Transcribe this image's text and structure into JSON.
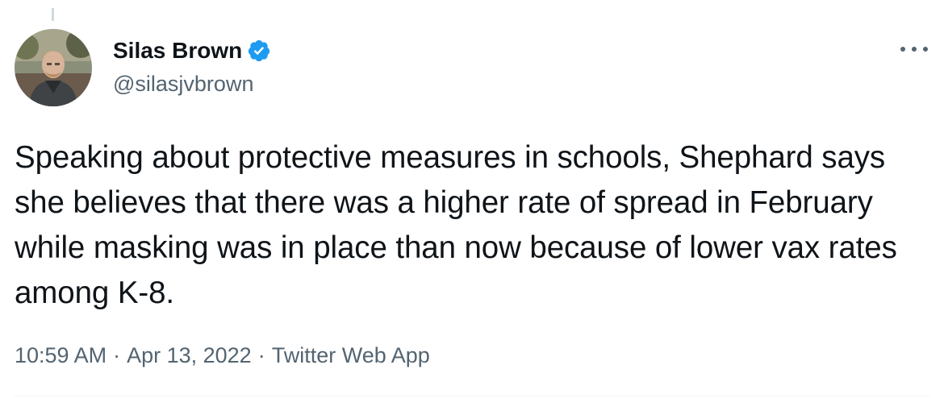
{
  "author": {
    "display_name": "Silas Brown",
    "handle": "@silasjvbrown",
    "verified": true,
    "avatar_icon": "user-avatar-photo"
  },
  "tweet": {
    "text": "Speaking about protective measures in schools, Shephard says she believes that there was a higher rate of spread in February while masking was in place than now because of lower vax rates among K-8.",
    "time": "10:59 AM",
    "separator": "·",
    "date": "Apr 13, 2022",
    "source": "Twitter Web App"
  },
  "icons": {
    "more": "more-horizontal-icon",
    "verified": "verified-badge-icon"
  },
  "colors": {
    "verified_blue": "#1d9bf0",
    "text_primary": "#0f1419",
    "text_secondary": "#536471"
  }
}
